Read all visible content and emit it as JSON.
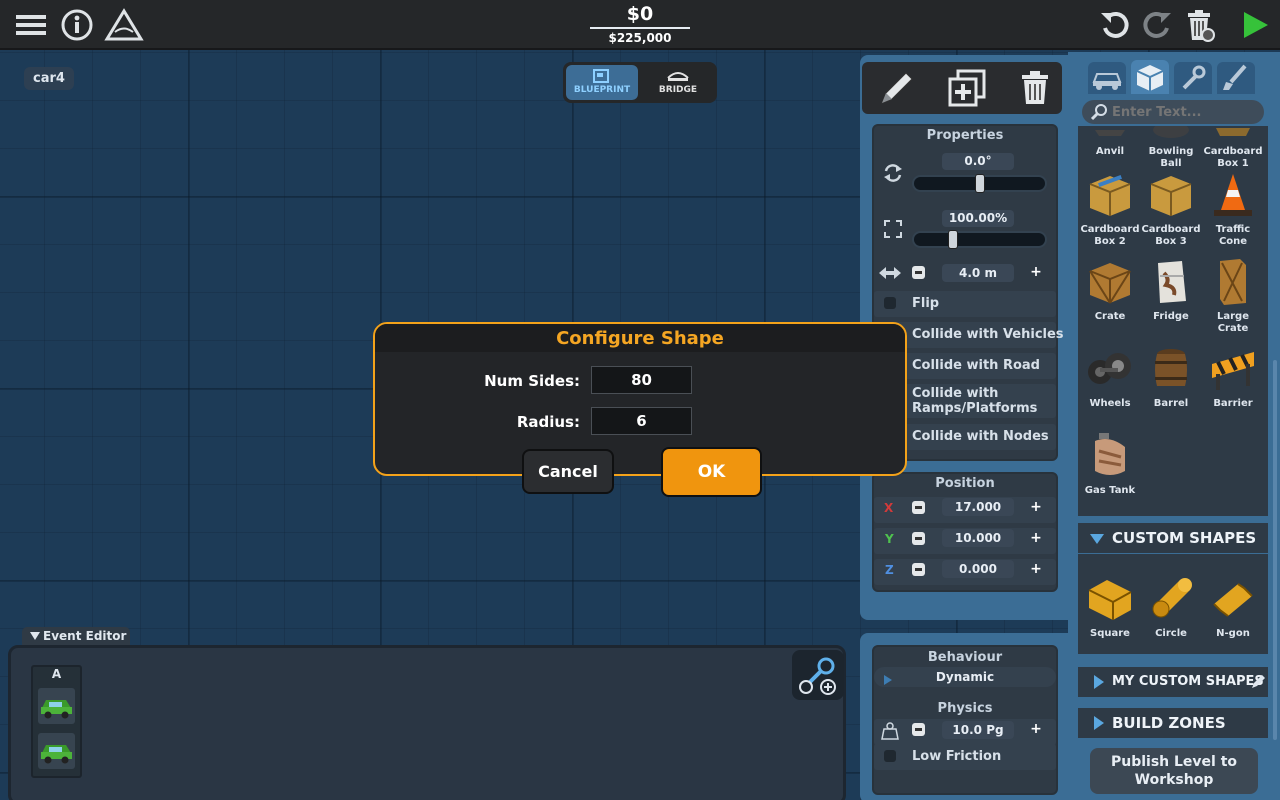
{
  "topbar": {
    "money": "$0",
    "budget": "$225,000"
  },
  "car_label": "car4",
  "mode_switch": {
    "blueprint": "BLUEPRINT",
    "bridge": "BRIDGE"
  },
  "properties": {
    "title": "Properties",
    "rotation": "0.0°",
    "rotation_fraction": 0.5,
    "scale": "100.00%",
    "scale_fraction": 0.28,
    "size": "4.0 m",
    "options": [
      "Flip",
      "Collide with Vehicles",
      "Collide with Road",
      "Collide with Ramps/Platforms",
      "Collide with Nodes"
    ]
  },
  "position": {
    "title": "Position",
    "x_label": "X",
    "x": "17.000",
    "y_label": "Y",
    "y": "10.000",
    "z_label": "Z",
    "z": "0.000"
  },
  "behaviour": {
    "title": "Behaviour",
    "value": "Dynamic",
    "physics_title": "Physics",
    "mass": "10.0 Pg",
    "low_friction": "Low Friction"
  },
  "palette": {
    "search_placeholder": "Enter Text...",
    "items": [
      {
        "label": "Anvil",
        "icon": "anvil-icon"
      },
      {
        "label": "Bowling Ball",
        "icon": "bowling-ball-icon"
      },
      {
        "label": "Cardboard Box 1",
        "icon": "cardboard-box-icon"
      },
      {
        "label": "Cardboard Box 2",
        "icon": "cardboard-box-icon"
      },
      {
        "label": "Cardboard Box 3",
        "icon": "cardboard-box-icon"
      },
      {
        "label": "Traffic Cone",
        "icon": "traffic-cone-icon"
      },
      {
        "label": "Crate",
        "icon": "crate-icon"
      },
      {
        "label": "Fridge",
        "icon": "fridge-icon"
      },
      {
        "label": "Large Crate",
        "icon": "large-crate-icon"
      },
      {
        "label": "Wheels",
        "icon": "wheels-icon"
      },
      {
        "label": "Barrel",
        "icon": "barrel-icon"
      },
      {
        "label": "Barrier",
        "icon": "barrier-icon"
      },
      {
        "label": "Gas Tank",
        "icon": "gas-tank-icon"
      }
    ],
    "custom_shapes_title": "CUSTOM SHAPES",
    "shapes": [
      {
        "label": "Square",
        "icon": "square-shape-icon"
      },
      {
        "label": "Circle",
        "icon": "circle-shape-icon"
      },
      {
        "label": "N-gon",
        "icon": "ngon-shape-icon"
      }
    ],
    "my_custom_shapes": "MY CUSTOM SHAPES",
    "build_zones": "BUILD ZONES",
    "publish": "Publish Level to Workshop"
  },
  "event_editor": {
    "tab": "Event Editor",
    "lane": "A"
  },
  "dialog": {
    "title": "Configure Shape",
    "num_sides_label": "Num Sides:",
    "num_sides": "80",
    "radius_label": "Radius:",
    "radius": "6",
    "cancel": "Cancel",
    "ok": "OK"
  },
  "colors": {
    "accent": "#f0950e",
    "panel_blue": "#3b6d95",
    "canvas": "#1d3b57"
  }
}
